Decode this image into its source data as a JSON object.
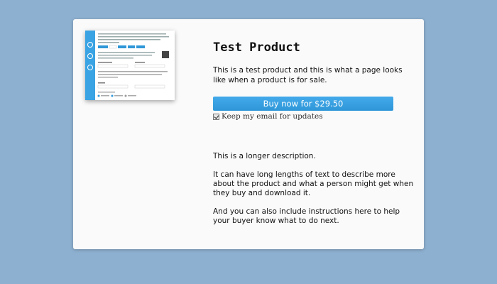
{
  "product": {
    "title": "Test Product",
    "short_description": "This is a test product and this is what a page looks like when a product is for sale.",
    "buy_button_label": "Buy now for $29.50",
    "email_option_label": "Keep my email for updates",
    "email_option_checked": true,
    "long_description": [
      "This is a longer description.",
      "It can have long lengths of text to describe more about the product and what a person might get when they buy and download it.",
      "And you can also include instructions here to help your buyer know what to do next."
    ]
  },
  "colors": {
    "page_background": "#8eb0d0",
    "card_background": "#fafafa",
    "button_background": "#3aa3e3",
    "thumbnail_sidebar": "#3aa3e3"
  },
  "icons": {
    "checkbox": "checkmark-icon"
  }
}
